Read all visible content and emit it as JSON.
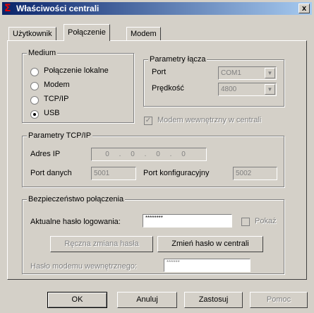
{
  "window": {
    "title": "Właściwości centrali",
    "close_label": "x",
    "icon": "sigma-icon"
  },
  "tabs": [
    {
      "label": "Użytkownik",
      "active": false
    },
    {
      "label": "Połączenie",
      "active": true
    },
    {
      "label": "Modem",
      "active": false
    }
  ],
  "medium": {
    "legend": "Medium",
    "options": [
      {
        "label": "Połączenie lokalne",
        "selected": false
      },
      {
        "label": "Modem",
        "selected": false
      },
      {
        "label": "TCP/IP",
        "selected": false
      },
      {
        "label": "USB",
        "selected": true
      }
    ]
  },
  "link_params": {
    "legend": "Parametry łącza",
    "port_label": "Port",
    "port_value": "COM1",
    "speed_label": "Prędkość",
    "speed_value": "4800",
    "internal_modem_label": "Modem wewnętrzny w centrali",
    "internal_modem_checked": true
  },
  "tcpip": {
    "legend": "Parametry TCP/IP",
    "ip_label": "Adres IP",
    "ip_octets": [
      "0",
      "0",
      "0",
      "0"
    ],
    "ip_dot": ".",
    "data_port_label": "Port danych",
    "data_port_value": "5001",
    "config_port_label": "Port konfiguracyjny",
    "config_port_value": "5002"
  },
  "security": {
    "legend": "Bezpieczeństwo połączenia",
    "current_password_label": "Aktualne hasło logowania:",
    "current_password_value": "********",
    "show_label": "Pokaż",
    "show_checked": false,
    "manual_change_label": "Ręczna zmiana hasła",
    "change_in_central_label": "Zmień hasło w centrali",
    "internal_modem_password_label": "Hasło modemu wewnętrznego:",
    "internal_modem_password_value": "******"
  },
  "buttons": {
    "ok": "OK",
    "cancel": "Anuluj",
    "apply": "Zastosuj",
    "help": "Pomoc"
  }
}
